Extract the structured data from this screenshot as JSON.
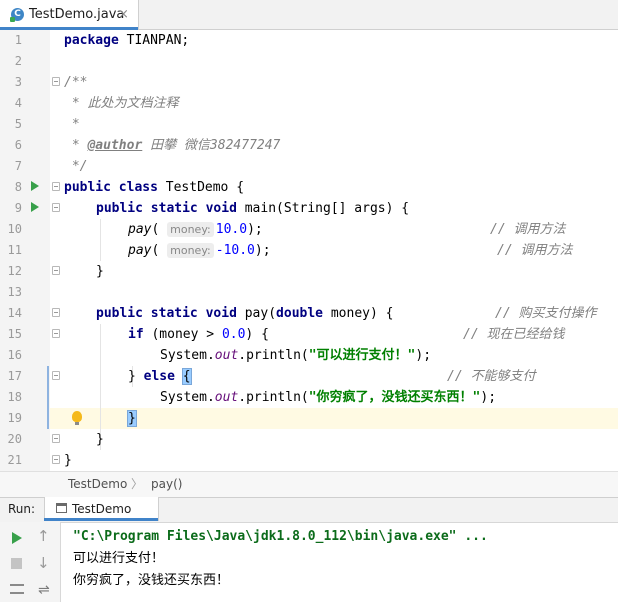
{
  "tab": {
    "label": "TestDemo.java",
    "close": "×",
    "icon": "class-icon"
  },
  "line_numbers": [
    "1",
    "2",
    "3",
    "4",
    "5",
    "6",
    "7",
    "8",
    "9",
    "10",
    "11",
    "12",
    "13",
    "14",
    "15",
    "16",
    "17",
    "18",
    "19",
    "20",
    "21"
  ],
  "code": {
    "l1_kw": "package",
    "l1_rest": " TIANPAN;",
    "l3": "/**",
    "l4": " * 此处为文档注释",
    "l5": " *",
    "l6_pre": " * ",
    "l6_tag": "@author",
    "l6_rest": " 田攀 微信382477247",
    "l7": " */",
    "l8_kw1": "public",
    "l8_kw2": "class",
    "l8_rest": " TestDemo {",
    "l9_kw1": "public",
    "l9_kw2": "static",
    "l9_kw3": "void",
    "l9_rest": " main(String[] args) {",
    "l10_fn": "pay",
    "l10_hint": "money:",
    "l10_num": "10.0",
    "l10_end": ");",
    "l10_cm": "// 调用方法",
    "l11_fn": "pay",
    "l11_hint": "money:",
    "l11_num": "-10.0",
    "l11_end": ");",
    "l11_cm": "// 调用方法",
    "l12": "}",
    "l14_kw1": "public",
    "l14_kw2": "static",
    "l14_kw3": "void",
    "l14_mid": " pay(",
    "l14_kw4": "double",
    "l14_rest": " money) {",
    "l14_cm": "// 购买支付操作",
    "l15_kw": "if",
    "l15_mid": " (money > ",
    "l15_num": "0.0",
    "l15_end": ") {",
    "l15_cm": "// 现在已经给钱",
    "l16_a": "System.",
    "l16_fld": "out",
    "l16_b": ".println(",
    "l16_str": "\"可以进行支付！\"",
    "l16_c": ");",
    "l17_a": "} ",
    "l17_kw": "else",
    "l17_sp": " ",
    "l17_brace": "{",
    "l17_cm": "// 不能够支付",
    "l18_a": "System.",
    "l18_fld": "out",
    "l18_b": ".println(",
    "l18_str": "\"你穷疯了，没钱还买东西！\"",
    "l18_c": ");",
    "l19": "}",
    "l20": "}",
    "l21": "}"
  },
  "breadcrumb": {
    "class": "TestDemo",
    "separator": "〉",
    "method": "pay()"
  },
  "run_panel": {
    "label": "Run:",
    "tab": "TestDemo",
    "command": "\"C:\\Program Files\\Java\\jdk1.8.0_112\\bin\\java.exe\" ...",
    "output": [
      "可以进行支付！",
      "你穷疯了，没钱还买东西！"
    ],
    "up": "↑",
    "down": "↓",
    "softwrap": "⇌"
  },
  "colors": {
    "keyword": "#000080",
    "comment": "#808080",
    "number": "#0000ff",
    "string": "#008000",
    "run": "#38a04a",
    "accent": "#4083c9"
  }
}
